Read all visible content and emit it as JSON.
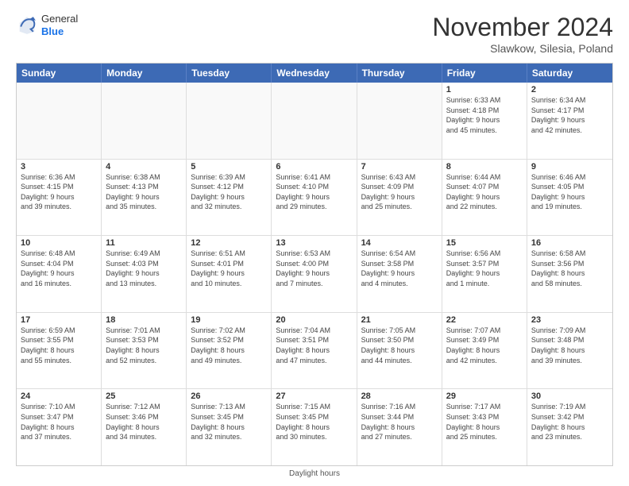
{
  "logo": {
    "general": "General",
    "blue": "Blue"
  },
  "title": "November 2024",
  "subtitle": "Slawkow, Silesia, Poland",
  "days_header": [
    "Sunday",
    "Monday",
    "Tuesday",
    "Wednesday",
    "Thursday",
    "Friday",
    "Saturday"
  ],
  "footer": "Daylight hours",
  "weeks": [
    [
      {
        "day": "",
        "info": "",
        "empty": true
      },
      {
        "day": "",
        "info": "",
        "empty": true
      },
      {
        "day": "",
        "info": "",
        "empty": true
      },
      {
        "day": "",
        "info": "",
        "empty": true
      },
      {
        "day": "",
        "info": "",
        "empty": true
      },
      {
        "day": "1",
        "info": "Sunrise: 6:33 AM\nSunset: 4:18 PM\nDaylight: 9 hours\nand 45 minutes.",
        "empty": false
      },
      {
        "day": "2",
        "info": "Sunrise: 6:34 AM\nSunset: 4:17 PM\nDaylight: 9 hours\nand 42 minutes.",
        "empty": false
      }
    ],
    [
      {
        "day": "3",
        "info": "Sunrise: 6:36 AM\nSunset: 4:15 PM\nDaylight: 9 hours\nand 39 minutes.",
        "empty": false
      },
      {
        "day": "4",
        "info": "Sunrise: 6:38 AM\nSunset: 4:13 PM\nDaylight: 9 hours\nand 35 minutes.",
        "empty": false
      },
      {
        "day": "5",
        "info": "Sunrise: 6:39 AM\nSunset: 4:12 PM\nDaylight: 9 hours\nand 32 minutes.",
        "empty": false
      },
      {
        "day": "6",
        "info": "Sunrise: 6:41 AM\nSunset: 4:10 PM\nDaylight: 9 hours\nand 29 minutes.",
        "empty": false
      },
      {
        "day": "7",
        "info": "Sunrise: 6:43 AM\nSunset: 4:09 PM\nDaylight: 9 hours\nand 25 minutes.",
        "empty": false
      },
      {
        "day": "8",
        "info": "Sunrise: 6:44 AM\nSunset: 4:07 PM\nDaylight: 9 hours\nand 22 minutes.",
        "empty": false
      },
      {
        "day": "9",
        "info": "Sunrise: 6:46 AM\nSunset: 4:05 PM\nDaylight: 9 hours\nand 19 minutes.",
        "empty": false
      }
    ],
    [
      {
        "day": "10",
        "info": "Sunrise: 6:48 AM\nSunset: 4:04 PM\nDaylight: 9 hours\nand 16 minutes.",
        "empty": false
      },
      {
        "day": "11",
        "info": "Sunrise: 6:49 AM\nSunset: 4:03 PM\nDaylight: 9 hours\nand 13 minutes.",
        "empty": false
      },
      {
        "day": "12",
        "info": "Sunrise: 6:51 AM\nSunset: 4:01 PM\nDaylight: 9 hours\nand 10 minutes.",
        "empty": false
      },
      {
        "day": "13",
        "info": "Sunrise: 6:53 AM\nSunset: 4:00 PM\nDaylight: 9 hours\nand 7 minutes.",
        "empty": false
      },
      {
        "day": "14",
        "info": "Sunrise: 6:54 AM\nSunset: 3:58 PM\nDaylight: 9 hours\nand 4 minutes.",
        "empty": false
      },
      {
        "day": "15",
        "info": "Sunrise: 6:56 AM\nSunset: 3:57 PM\nDaylight: 9 hours\nand 1 minute.",
        "empty": false
      },
      {
        "day": "16",
        "info": "Sunrise: 6:58 AM\nSunset: 3:56 PM\nDaylight: 8 hours\nand 58 minutes.",
        "empty": false
      }
    ],
    [
      {
        "day": "17",
        "info": "Sunrise: 6:59 AM\nSunset: 3:55 PM\nDaylight: 8 hours\nand 55 minutes.",
        "empty": false
      },
      {
        "day": "18",
        "info": "Sunrise: 7:01 AM\nSunset: 3:53 PM\nDaylight: 8 hours\nand 52 minutes.",
        "empty": false
      },
      {
        "day": "19",
        "info": "Sunrise: 7:02 AM\nSunset: 3:52 PM\nDaylight: 8 hours\nand 49 minutes.",
        "empty": false
      },
      {
        "day": "20",
        "info": "Sunrise: 7:04 AM\nSunset: 3:51 PM\nDaylight: 8 hours\nand 47 minutes.",
        "empty": false
      },
      {
        "day": "21",
        "info": "Sunrise: 7:05 AM\nSunset: 3:50 PM\nDaylight: 8 hours\nand 44 minutes.",
        "empty": false
      },
      {
        "day": "22",
        "info": "Sunrise: 7:07 AM\nSunset: 3:49 PM\nDaylight: 8 hours\nand 42 minutes.",
        "empty": false
      },
      {
        "day": "23",
        "info": "Sunrise: 7:09 AM\nSunset: 3:48 PM\nDaylight: 8 hours\nand 39 minutes.",
        "empty": false
      }
    ],
    [
      {
        "day": "24",
        "info": "Sunrise: 7:10 AM\nSunset: 3:47 PM\nDaylight: 8 hours\nand 37 minutes.",
        "empty": false
      },
      {
        "day": "25",
        "info": "Sunrise: 7:12 AM\nSunset: 3:46 PM\nDaylight: 8 hours\nand 34 minutes.",
        "empty": false
      },
      {
        "day": "26",
        "info": "Sunrise: 7:13 AM\nSunset: 3:45 PM\nDaylight: 8 hours\nand 32 minutes.",
        "empty": false
      },
      {
        "day": "27",
        "info": "Sunrise: 7:15 AM\nSunset: 3:45 PM\nDaylight: 8 hours\nand 30 minutes.",
        "empty": false
      },
      {
        "day": "28",
        "info": "Sunrise: 7:16 AM\nSunset: 3:44 PM\nDaylight: 8 hours\nand 27 minutes.",
        "empty": false
      },
      {
        "day": "29",
        "info": "Sunrise: 7:17 AM\nSunset: 3:43 PM\nDaylight: 8 hours\nand 25 minutes.",
        "empty": false
      },
      {
        "day": "30",
        "info": "Sunrise: 7:19 AM\nSunset: 3:42 PM\nDaylight: 8 hours\nand 23 minutes.",
        "empty": false
      }
    ]
  ]
}
